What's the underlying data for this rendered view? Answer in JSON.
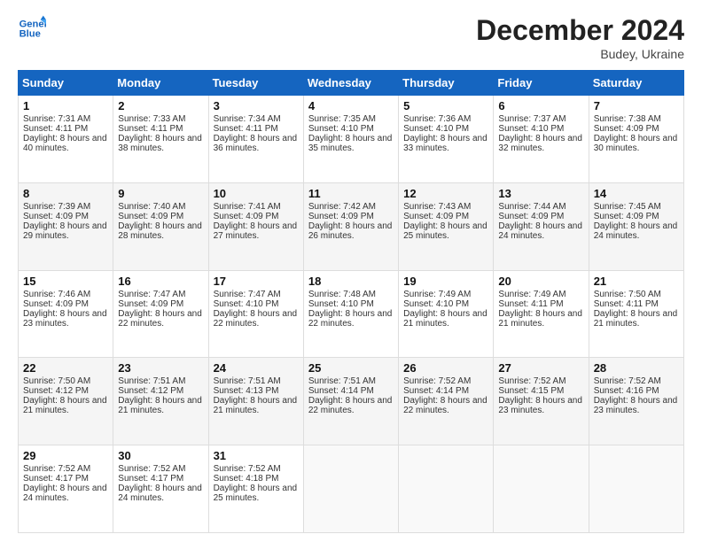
{
  "logo": {
    "line1": "General",
    "line2": "Blue"
  },
  "title": "December 2024",
  "subtitle": "Budey, Ukraine",
  "days_header": [
    "Sunday",
    "Monday",
    "Tuesday",
    "Wednesday",
    "Thursday",
    "Friday",
    "Saturday"
  ],
  "weeks": [
    [
      {
        "num": "1",
        "sunrise": "Sunrise: 7:31 AM",
        "sunset": "Sunset: 4:11 PM",
        "daylight": "Daylight: 8 hours and 40 minutes."
      },
      {
        "num": "2",
        "sunrise": "Sunrise: 7:33 AM",
        "sunset": "Sunset: 4:11 PM",
        "daylight": "Daylight: 8 hours and 38 minutes."
      },
      {
        "num": "3",
        "sunrise": "Sunrise: 7:34 AM",
        "sunset": "Sunset: 4:11 PM",
        "daylight": "Daylight: 8 hours and 36 minutes."
      },
      {
        "num": "4",
        "sunrise": "Sunrise: 7:35 AM",
        "sunset": "Sunset: 4:10 PM",
        "daylight": "Daylight: 8 hours and 35 minutes."
      },
      {
        "num": "5",
        "sunrise": "Sunrise: 7:36 AM",
        "sunset": "Sunset: 4:10 PM",
        "daylight": "Daylight: 8 hours and 33 minutes."
      },
      {
        "num": "6",
        "sunrise": "Sunrise: 7:37 AM",
        "sunset": "Sunset: 4:10 PM",
        "daylight": "Daylight: 8 hours and 32 minutes."
      },
      {
        "num": "7",
        "sunrise": "Sunrise: 7:38 AM",
        "sunset": "Sunset: 4:09 PM",
        "daylight": "Daylight: 8 hours and 30 minutes."
      }
    ],
    [
      {
        "num": "8",
        "sunrise": "Sunrise: 7:39 AM",
        "sunset": "Sunset: 4:09 PM",
        "daylight": "Daylight: 8 hours and 29 minutes."
      },
      {
        "num": "9",
        "sunrise": "Sunrise: 7:40 AM",
        "sunset": "Sunset: 4:09 PM",
        "daylight": "Daylight: 8 hours and 28 minutes."
      },
      {
        "num": "10",
        "sunrise": "Sunrise: 7:41 AM",
        "sunset": "Sunset: 4:09 PM",
        "daylight": "Daylight: 8 hours and 27 minutes."
      },
      {
        "num": "11",
        "sunrise": "Sunrise: 7:42 AM",
        "sunset": "Sunset: 4:09 PM",
        "daylight": "Daylight: 8 hours and 26 minutes."
      },
      {
        "num": "12",
        "sunrise": "Sunrise: 7:43 AM",
        "sunset": "Sunset: 4:09 PM",
        "daylight": "Daylight: 8 hours and 25 minutes."
      },
      {
        "num": "13",
        "sunrise": "Sunrise: 7:44 AM",
        "sunset": "Sunset: 4:09 PM",
        "daylight": "Daylight: 8 hours and 24 minutes."
      },
      {
        "num": "14",
        "sunrise": "Sunrise: 7:45 AM",
        "sunset": "Sunset: 4:09 PM",
        "daylight": "Daylight: 8 hours and 24 minutes."
      }
    ],
    [
      {
        "num": "15",
        "sunrise": "Sunrise: 7:46 AM",
        "sunset": "Sunset: 4:09 PM",
        "daylight": "Daylight: 8 hours and 23 minutes."
      },
      {
        "num": "16",
        "sunrise": "Sunrise: 7:47 AM",
        "sunset": "Sunset: 4:09 PM",
        "daylight": "Daylight: 8 hours and 22 minutes."
      },
      {
        "num": "17",
        "sunrise": "Sunrise: 7:47 AM",
        "sunset": "Sunset: 4:10 PM",
        "daylight": "Daylight: 8 hours and 22 minutes."
      },
      {
        "num": "18",
        "sunrise": "Sunrise: 7:48 AM",
        "sunset": "Sunset: 4:10 PM",
        "daylight": "Daylight: 8 hours and 22 minutes."
      },
      {
        "num": "19",
        "sunrise": "Sunrise: 7:49 AM",
        "sunset": "Sunset: 4:10 PM",
        "daylight": "Daylight: 8 hours and 21 minutes."
      },
      {
        "num": "20",
        "sunrise": "Sunrise: 7:49 AM",
        "sunset": "Sunset: 4:11 PM",
        "daylight": "Daylight: 8 hours and 21 minutes."
      },
      {
        "num": "21",
        "sunrise": "Sunrise: 7:50 AM",
        "sunset": "Sunset: 4:11 PM",
        "daylight": "Daylight: 8 hours and 21 minutes."
      }
    ],
    [
      {
        "num": "22",
        "sunrise": "Sunrise: 7:50 AM",
        "sunset": "Sunset: 4:12 PM",
        "daylight": "Daylight: 8 hours and 21 minutes."
      },
      {
        "num": "23",
        "sunrise": "Sunrise: 7:51 AM",
        "sunset": "Sunset: 4:12 PM",
        "daylight": "Daylight: 8 hours and 21 minutes."
      },
      {
        "num": "24",
        "sunrise": "Sunrise: 7:51 AM",
        "sunset": "Sunset: 4:13 PM",
        "daylight": "Daylight: 8 hours and 21 minutes."
      },
      {
        "num": "25",
        "sunrise": "Sunrise: 7:51 AM",
        "sunset": "Sunset: 4:14 PM",
        "daylight": "Daylight: 8 hours and 22 minutes."
      },
      {
        "num": "26",
        "sunrise": "Sunrise: 7:52 AM",
        "sunset": "Sunset: 4:14 PM",
        "daylight": "Daylight: 8 hours and 22 minutes."
      },
      {
        "num": "27",
        "sunrise": "Sunrise: 7:52 AM",
        "sunset": "Sunset: 4:15 PM",
        "daylight": "Daylight: 8 hours and 23 minutes."
      },
      {
        "num": "28",
        "sunrise": "Sunrise: 7:52 AM",
        "sunset": "Sunset: 4:16 PM",
        "daylight": "Daylight: 8 hours and 23 minutes."
      }
    ],
    [
      {
        "num": "29",
        "sunrise": "Sunrise: 7:52 AM",
        "sunset": "Sunset: 4:17 PM",
        "daylight": "Daylight: 8 hours and 24 minutes."
      },
      {
        "num": "30",
        "sunrise": "Sunrise: 7:52 AM",
        "sunset": "Sunset: 4:17 PM",
        "daylight": "Daylight: 8 hours and 24 minutes."
      },
      {
        "num": "31",
        "sunrise": "Sunrise: 7:52 AM",
        "sunset": "Sunset: 4:18 PM",
        "daylight": "Daylight: 8 hours and 25 minutes."
      },
      null,
      null,
      null,
      null
    ]
  ]
}
